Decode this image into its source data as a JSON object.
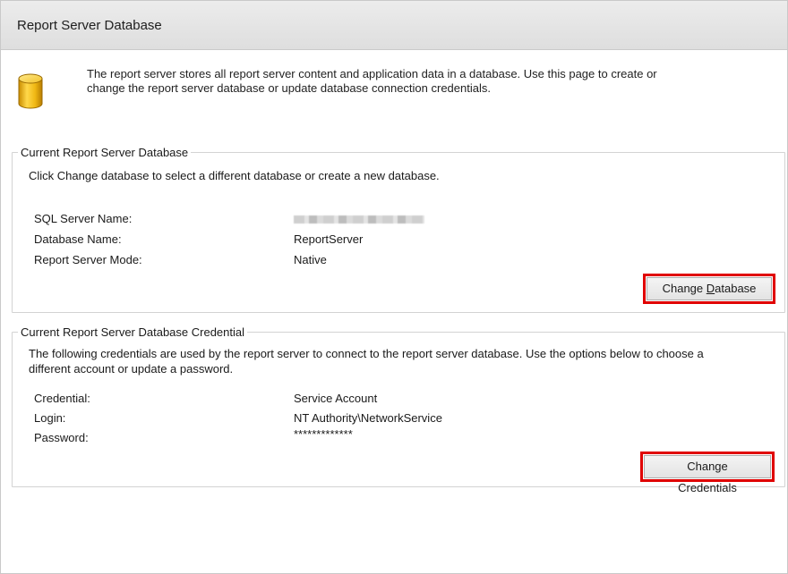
{
  "header": {
    "title": "Report Server Database"
  },
  "intro": {
    "icon": "database-icon",
    "text_line1": "The report server stores all report server content and application data in a database. Use this page to create or",
    "text_line2": "change the report server database or update database connection credentials."
  },
  "current_database": {
    "legend": "Current Report Server Database",
    "description": "Click Change database to select a different database or create a new database.",
    "rows": [
      {
        "label": "SQL Server Name:",
        "value": ""
      },
      {
        "label": "Database Name:",
        "value": "ReportServer"
      },
      {
        "label": "Report Server Mode:",
        "value": "Native"
      }
    ],
    "button_prefix": "Change ",
    "button_mnemonic": "D",
    "button_suffix": "atabase"
  },
  "credentials": {
    "legend": "Current Report Server Database Credential",
    "description_line1": "The following credentials are used by the report server to connect to the report server database.  Use the options below to choose a",
    "description_line2": "different account or update a password.",
    "rows": [
      {
        "label": "Credential:",
        "value": "Service Account"
      },
      {
        "label": "Login:",
        "value": "NT Authority\\NetworkService"
      },
      {
        "label": "Password:",
        "value": "*************"
      }
    ],
    "button_prefix": "Chan",
    "button_mnemonic": "g",
    "button_suffix": "e Credentials"
  },
  "colors": {
    "highlight_border": "#e00000",
    "header_bg": "#e4e4e4",
    "icon_gold": "#e8b410"
  }
}
